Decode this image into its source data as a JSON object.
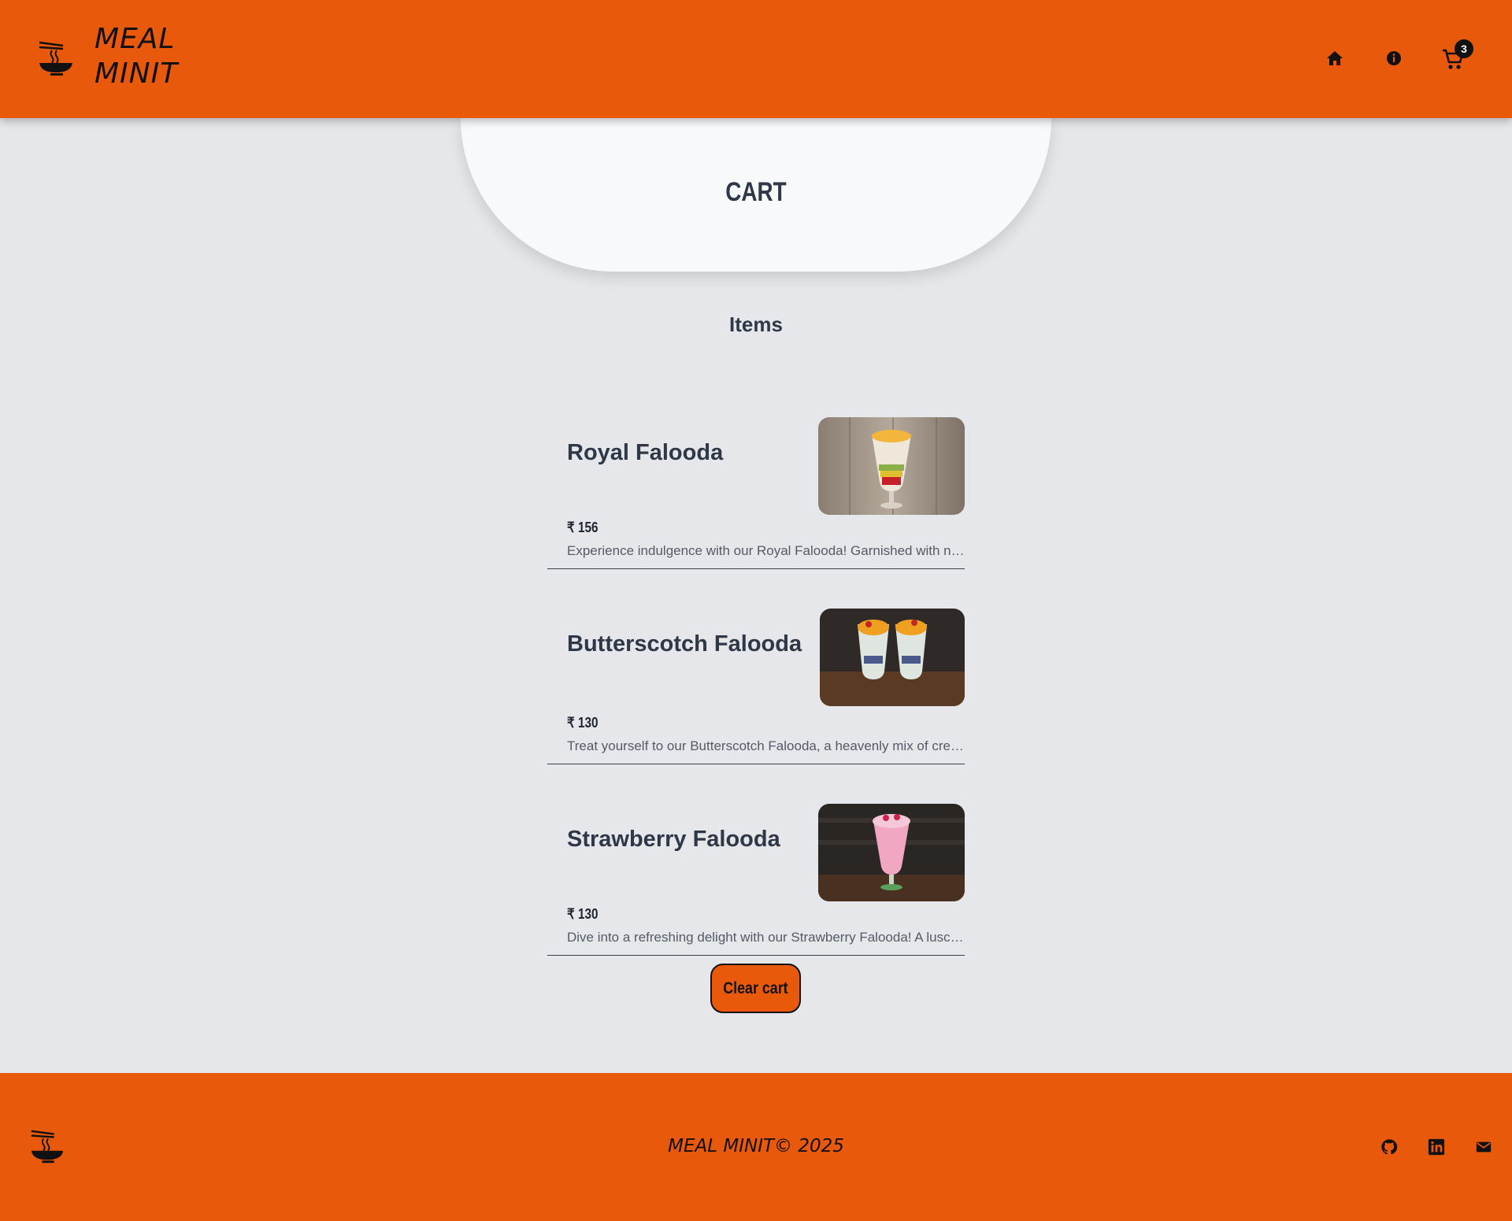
{
  "header": {
    "brand_line1": "MEAL",
    "brand_line2": "MINIT",
    "cart_count": "3",
    "icons": [
      "bowl-chopsticks-icon",
      "home-icon",
      "info-icon",
      "cart-icon"
    ]
  },
  "page": {
    "title": "CART",
    "items_heading": "Items"
  },
  "items": [
    {
      "name": "Royal Falooda",
      "price": "₹ 156",
      "description": "Experience indulgence with our Royal Falooda! Garnished with nuts..."
    },
    {
      "name": "Butterscotch Falooda",
      "price": "₹ 130",
      "description": "Treat yourself to our Butterscotch Falooda, a heavenly mix of cream..."
    },
    {
      "name": "Strawberry Falooda",
      "price": "₹ 130",
      "description": "Dive into a refreshing delight with our Strawberry Falooda! A luscio..."
    }
  ],
  "actions": {
    "clear_cart_label": "Clear cart"
  },
  "footer": {
    "copyright": "MEAL MINIT© 2025",
    "social": [
      "github-icon",
      "linkedin-icon",
      "mail-icon"
    ]
  },
  "colors": {
    "brand_orange": "#e8590c",
    "page_bg": "#e6e7ea",
    "text_dark": "#2e3846"
  }
}
